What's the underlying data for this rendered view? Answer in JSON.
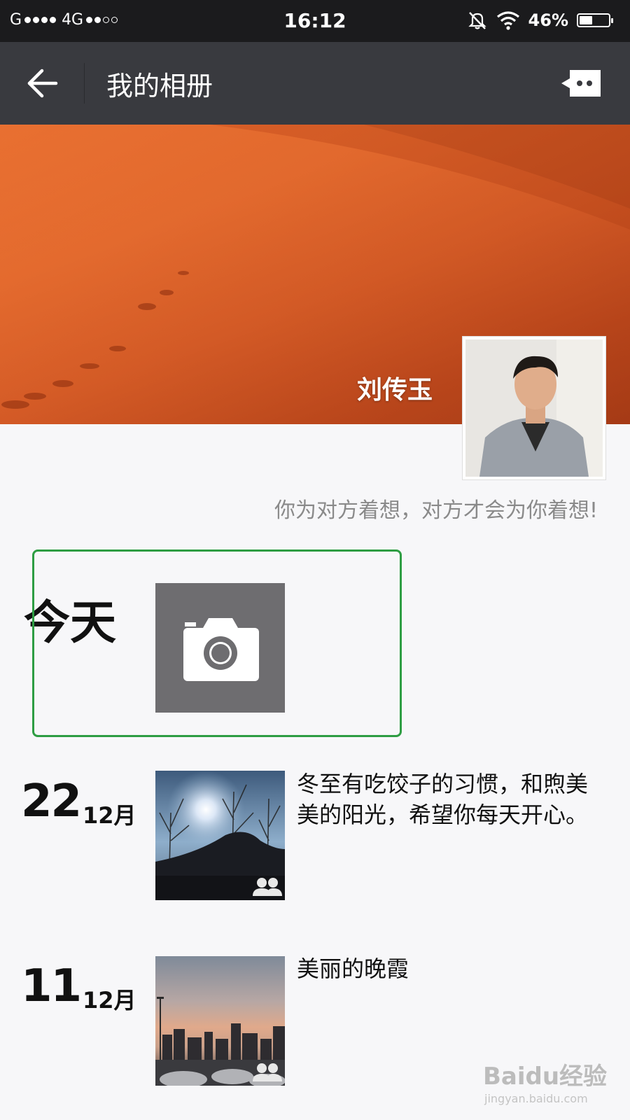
{
  "status_bar": {
    "carrier": "G",
    "network": "4G",
    "time": "16:12",
    "battery": "46%",
    "battery_level": 0.46
  },
  "header": {
    "title": "我的相册",
    "back_icon": "arrow-left-icon",
    "message_icon": "message-bubble-icon"
  },
  "profile": {
    "name": "刘传玉",
    "signature": "你为对方着想，对方才会为你着想!"
  },
  "today": {
    "label": "今天",
    "camera_icon": "camera-icon"
  },
  "posts": [
    {
      "day": "22",
      "month": "12月",
      "text": "冬至有吃饺子的习惯，和煦美美的阳光，希望你每天开心。",
      "visibility_icon": "group-icon"
    },
    {
      "day": "11",
      "month": "12月",
      "text": "美丽的晚霞",
      "visibility_icon": "group-icon"
    }
  ],
  "watermark": {
    "brand": "Baidu经验",
    "url": "jingyan.baidu.com"
  },
  "colors": {
    "navbar": "#393a3f",
    "statusbar": "#1b1b1d",
    "highlight": "#2e9d43",
    "camera_tile": "#6e6d70"
  }
}
